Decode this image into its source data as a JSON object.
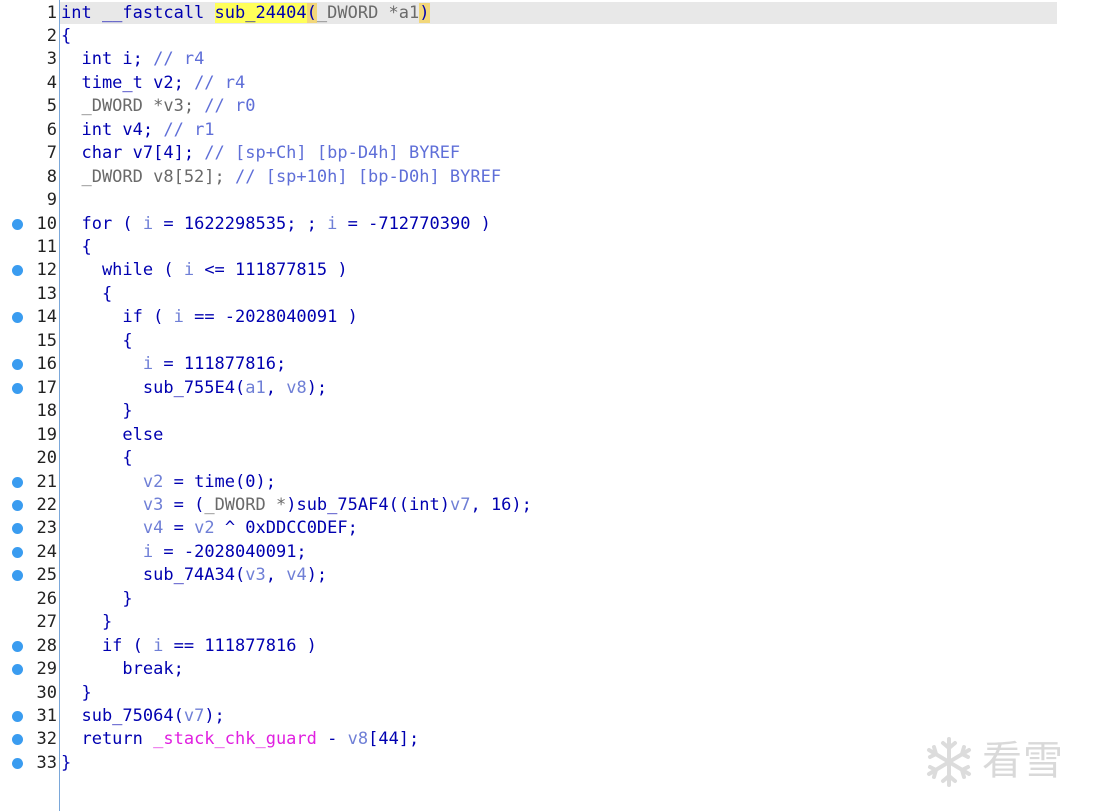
{
  "lines": [
    {
      "n": "1",
      "bp": false,
      "tokens": [
        {
          "t": "int __fastcall ",
          "c": "t-kw"
        },
        {
          "t": "sub_24404",
          "c": "t-fn t-hl"
        },
        {
          "t": "(",
          "c": "t-plain t-paren"
        },
        {
          "t": "_DWORD *a1",
          "c": "t-type"
        },
        {
          "t": ")",
          "c": "t-plain t-paren"
        }
      ]
    },
    {
      "n": "2",
      "bp": false,
      "tokens": [
        {
          "t": "{",
          "c": "t-plain"
        }
      ]
    },
    {
      "n": "3",
      "bp": false,
      "tokens": [
        {
          "t": "  int i; ",
          "c": "t-kw"
        },
        {
          "t": "// r4",
          "c": "t-cmt"
        }
      ]
    },
    {
      "n": "4",
      "bp": false,
      "tokens": [
        {
          "t": "  time_t v2; ",
          "c": "t-kw"
        },
        {
          "t": "// r4",
          "c": "t-cmt"
        }
      ]
    },
    {
      "n": "5",
      "bp": false,
      "tokens": [
        {
          "t": "  _DWORD *v3; ",
          "c": "t-type"
        },
        {
          "t": "// r0",
          "c": "t-cmt"
        }
      ]
    },
    {
      "n": "6",
      "bp": false,
      "tokens": [
        {
          "t": "  int v4; ",
          "c": "t-kw"
        },
        {
          "t": "// r1",
          "c": "t-cmt"
        }
      ]
    },
    {
      "n": "7",
      "bp": false,
      "tokens": [
        {
          "t": "  char v7[4]; ",
          "c": "t-kw"
        },
        {
          "t": "// [sp+Ch] [bp-D4h] BYREF",
          "c": "t-cmt"
        }
      ]
    },
    {
      "n": "8",
      "bp": false,
      "tokens": [
        {
          "t": "  _DWORD v8[52]; ",
          "c": "t-type"
        },
        {
          "t": "// [sp+10h] [bp-D0h] BYREF",
          "c": "t-cmt"
        }
      ]
    },
    {
      "n": "9",
      "bp": false,
      "tokens": []
    },
    {
      "n": "10",
      "bp": true,
      "tokens": [
        {
          "t": "  for ( ",
          "c": "t-kw"
        },
        {
          "t": "i",
          "c": "t-var"
        },
        {
          "t": " = 1622298535; ; ",
          "c": "t-plain"
        },
        {
          "t": "i",
          "c": "t-var"
        },
        {
          "t": " = -712770390 )",
          "c": "t-plain"
        }
      ]
    },
    {
      "n": "11",
      "bp": false,
      "tokens": [
        {
          "t": "  {",
          "c": "t-plain"
        }
      ]
    },
    {
      "n": "12",
      "bp": true,
      "tokens": [
        {
          "t": "    while ( ",
          "c": "t-kw"
        },
        {
          "t": "i",
          "c": "t-var"
        },
        {
          "t": " <= 111877815 )",
          "c": "t-plain"
        }
      ]
    },
    {
      "n": "13",
      "bp": false,
      "tokens": [
        {
          "t": "    {",
          "c": "t-plain"
        }
      ]
    },
    {
      "n": "14",
      "bp": true,
      "tokens": [
        {
          "t": "      if ( ",
          "c": "t-kw"
        },
        {
          "t": "i",
          "c": "t-var"
        },
        {
          "t": " == -2028040091 )",
          "c": "t-plain"
        }
      ]
    },
    {
      "n": "15",
      "bp": false,
      "tokens": [
        {
          "t": "      {",
          "c": "t-plain"
        }
      ]
    },
    {
      "n": "16",
      "bp": true,
      "tokens": [
        {
          "t": "        ",
          "c": "t-plain"
        },
        {
          "t": "i",
          "c": "t-var"
        },
        {
          "t": " = 111877816;",
          "c": "t-plain"
        }
      ]
    },
    {
      "n": "17",
      "bp": true,
      "tokens": [
        {
          "t": "        sub_755E4(",
          "c": "t-fn"
        },
        {
          "t": "a1",
          "c": "t-var"
        },
        {
          "t": ", ",
          "c": "t-plain"
        },
        {
          "t": "v8",
          "c": "t-var"
        },
        {
          "t": ");",
          "c": "t-plain"
        }
      ]
    },
    {
      "n": "18",
      "bp": false,
      "tokens": [
        {
          "t": "      }",
          "c": "t-plain"
        }
      ]
    },
    {
      "n": "19",
      "bp": false,
      "tokens": [
        {
          "t": "      else",
          "c": "t-kw"
        }
      ]
    },
    {
      "n": "20",
      "bp": false,
      "tokens": [
        {
          "t": "      {",
          "c": "t-plain"
        }
      ]
    },
    {
      "n": "21",
      "bp": true,
      "tokens": [
        {
          "t": "        ",
          "c": "t-plain"
        },
        {
          "t": "v2",
          "c": "t-var"
        },
        {
          "t": " = time(0);",
          "c": "t-plain"
        }
      ]
    },
    {
      "n": "22",
      "bp": true,
      "tokens": [
        {
          "t": "        ",
          "c": "t-plain"
        },
        {
          "t": "v3",
          "c": "t-var"
        },
        {
          "t": " = (",
          "c": "t-plain"
        },
        {
          "t": "_DWORD *",
          "c": "t-type"
        },
        {
          "t": ")sub_75AF4((int)",
          "c": "t-plain"
        },
        {
          "t": "v7",
          "c": "t-var"
        },
        {
          "t": ", 16);",
          "c": "t-plain"
        }
      ]
    },
    {
      "n": "23",
      "bp": true,
      "tokens": [
        {
          "t": "        ",
          "c": "t-plain"
        },
        {
          "t": "v4",
          "c": "t-var"
        },
        {
          "t": " = ",
          "c": "t-plain"
        },
        {
          "t": "v2",
          "c": "t-var"
        },
        {
          "t": " ^ 0xDDCC0DEF;",
          "c": "t-plain"
        }
      ]
    },
    {
      "n": "24",
      "bp": true,
      "tokens": [
        {
          "t": "        ",
          "c": "t-plain"
        },
        {
          "t": "i",
          "c": "t-var"
        },
        {
          "t": " = -2028040091;",
          "c": "t-plain"
        }
      ]
    },
    {
      "n": "25",
      "bp": true,
      "tokens": [
        {
          "t": "        sub_74A34(",
          "c": "t-fn"
        },
        {
          "t": "v3",
          "c": "t-var"
        },
        {
          "t": ", ",
          "c": "t-plain"
        },
        {
          "t": "v4",
          "c": "t-var"
        },
        {
          "t": ");",
          "c": "t-plain"
        }
      ]
    },
    {
      "n": "26",
      "bp": false,
      "tokens": [
        {
          "t": "      }",
          "c": "t-plain"
        }
      ]
    },
    {
      "n": "27",
      "bp": false,
      "tokens": [
        {
          "t": "    }",
          "c": "t-plain"
        }
      ]
    },
    {
      "n": "28",
      "bp": true,
      "tokens": [
        {
          "t": "    if ( ",
          "c": "t-kw"
        },
        {
          "t": "i",
          "c": "t-var"
        },
        {
          "t": " == 111877816 )",
          "c": "t-plain"
        }
      ]
    },
    {
      "n": "29",
      "bp": true,
      "tokens": [
        {
          "t": "      break;",
          "c": "t-kw"
        }
      ]
    },
    {
      "n": "30",
      "bp": false,
      "tokens": [
        {
          "t": "  }",
          "c": "t-plain"
        }
      ]
    },
    {
      "n": "31",
      "bp": true,
      "tokens": [
        {
          "t": "  sub_75064(",
          "c": "t-fn"
        },
        {
          "t": "v7",
          "c": "t-var"
        },
        {
          "t": ");",
          "c": "t-plain"
        }
      ]
    },
    {
      "n": "32",
      "bp": true,
      "tokens": [
        {
          "t": "  return ",
          "c": "t-kw"
        },
        {
          "t": "_stack_chk_guard",
          "c": "t-glob"
        },
        {
          "t": " - ",
          "c": "t-plain"
        },
        {
          "t": "v8",
          "c": "t-var"
        },
        {
          "t": "[44];",
          "c": "t-plain"
        }
      ]
    },
    {
      "n": "33",
      "bp": true,
      "tokens": [
        {
          "t": "}",
          "c": "t-plain"
        }
      ]
    }
  ],
  "watermark": {
    "text": "看雪",
    "icon": "snowflake-logo-icon"
  },
  "colors": {
    "keyword": "#0000b0",
    "variable": "#6f7fd6",
    "comment": "#5f6fd8",
    "type": "#6a6a6a",
    "global": "#e020e0",
    "highlight": "#ffff5a",
    "breakpoint": "#3a9cf0"
  }
}
